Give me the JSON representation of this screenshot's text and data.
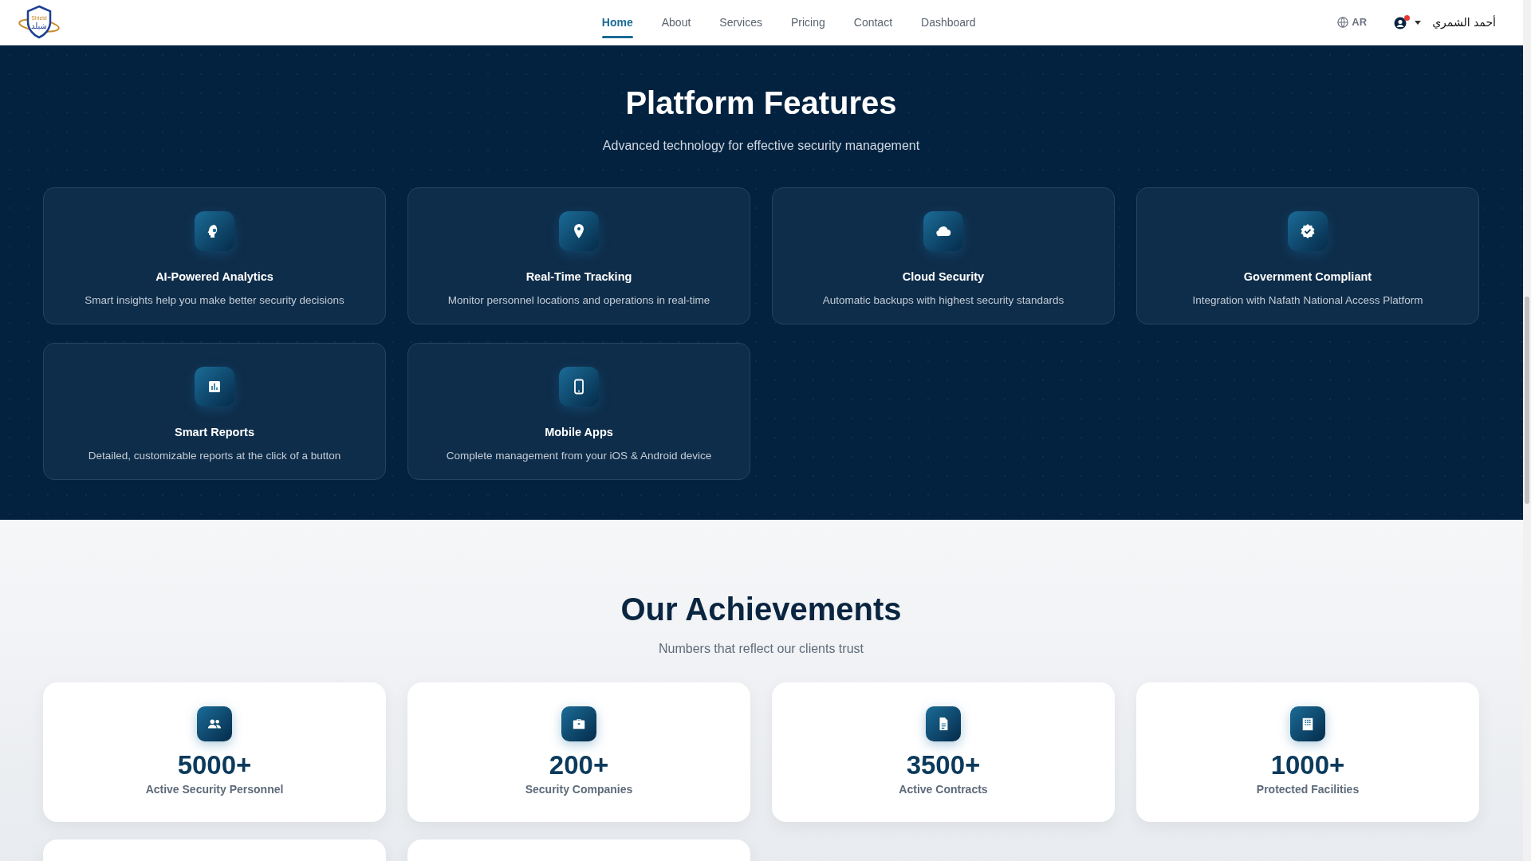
{
  "navbar": {
    "logo": {
      "text_en": "Shield",
      "text_ar": "شيلد"
    },
    "links": [
      {
        "label": "Home",
        "selected": true
      },
      {
        "label": "About",
        "selected": false
      },
      {
        "label": "Services",
        "selected": false
      },
      {
        "label": "Pricing",
        "selected": false
      },
      {
        "label": "Contact",
        "selected": false
      },
      {
        "label": "Dashboard",
        "selected": false
      }
    ],
    "language": "AR",
    "user": {
      "name": "أحمد الشمري",
      "notification": true
    }
  },
  "features": {
    "title": "Platform Features",
    "subtitle": "Advanced technology for effective security management",
    "items": [
      {
        "kind": "brain",
        "title": "AI-Powered Analytics",
        "description": "Smart insights help you make better security decisions"
      },
      {
        "kind": "pin",
        "title": "Real-Time Tracking",
        "description": "Monitor personnel locations and operations in real-time"
      },
      {
        "kind": "cloud",
        "title": "Cloud Security",
        "description": "Automatic backups with highest security standards"
      },
      {
        "kind": "badge",
        "title": "Government Compliant",
        "description": "Integration with Nafath National Access Platform"
      },
      {
        "kind": "chart",
        "title": "Smart Reports",
        "description": "Detailed, customizable reports at the click of a button"
      },
      {
        "kind": "phone",
        "title": "Mobile Apps",
        "description": "Complete management from your iOS & Android device"
      }
    ]
  },
  "achievements": {
    "title": "Our Achievements",
    "subtitle": "Numbers that reflect our clients trust",
    "items": [
      {
        "kind": "people",
        "value": "5000+",
        "label": "Active Security Personnel"
      },
      {
        "kind": "briefcase",
        "value": "200+",
        "label": "Security Companies"
      },
      {
        "kind": "document",
        "value": "3500+",
        "label": "Active Contracts"
      },
      {
        "kind": "building",
        "value": "1000+",
        "label": "Protected Facilities"
      }
    ]
  }
}
